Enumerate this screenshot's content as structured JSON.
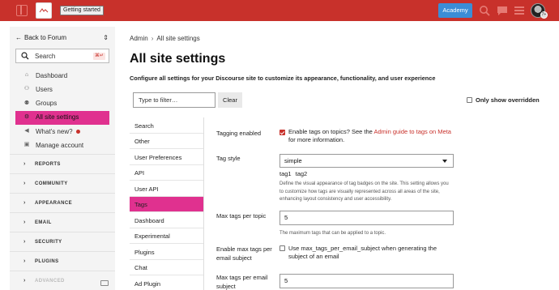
{
  "header": {
    "badge": "Getting started",
    "academy_label": "Academy",
    "icons": [
      "sidebar-toggle-icon",
      "search-icon",
      "chat-icon",
      "hamburger-menu-icon"
    ],
    "avatar_badge": "7+"
  },
  "sidebar": {
    "back_label": "Back to Forum",
    "search": {
      "label": "Search",
      "shortcut": "⌘↵"
    },
    "items": [
      {
        "label": "Dashboard",
        "icon": "home-icon"
      },
      {
        "label": "Users",
        "icon": "users-icon"
      },
      {
        "label": "Groups",
        "icon": "groups-icon"
      },
      {
        "label": "All site settings",
        "icon": "gear-icon",
        "active": true
      },
      {
        "label": "What's new?",
        "icon": "megaphone-icon"
      },
      {
        "label": "Manage account",
        "icon": "account-icon"
      }
    ],
    "sections": [
      "REPORTS",
      "COMMUNITY",
      "APPEARANCE",
      "EMAIL",
      "SECURITY",
      "PLUGINS",
      "ADVANCED"
    ]
  },
  "main": {
    "breadcrumb": {
      "root": "Admin",
      "current": "All site settings"
    },
    "title": "All site settings",
    "description": "Configure all settings for your Discourse site to customize its appearance, functionality, and user experience",
    "filter_placeholder": "Type to filter…",
    "clear_label": "Clear",
    "only_overridden_label": "Only show overridden",
    "categories": [
      "Search",
      "Other",
      "User Preferences",
      "API",
      "User API",
      "Tags",
      "Dashboard",
      "Experimental",
      "Plugins",
      "Chat",
      "Ad Plugin"
    ],
    "active_category": "Tags",
    "settings": {
      "tagging_enabled": {
        "label": "Tagging enabled",
        "text_before": "Enable tags on topics? See the ",
        "link": "Admin guide to tags on Meta",
        "text_after": " for more information."
      },
      "tag_style": {
        "label": "Tag style",
        "value": "simple",
        "preview_tags": [
          "tag1",
          "tag2"
        ],
        "help": "Define the visual appearance of tag badges on the site. This setting allows you to customize how tags are visually represented across all areas of the site, enhancing layout consistency and user accessibility."
      },
      "max_tags_per_topic": {
        "label": "Max tags per topic",
        "value": "5",
        "help": "The maximum tags that can be applied to a topic."
      },
      "enable_max_tags_per_email_subject": {
        "label": "Enable max tags per email subject",
        "text": "Use max_tags_per_email_subject when generating the subject of an email"
      },
      "max_tags_per_email_subject": {
        "label": "Max tags per email subject",
        "value": "5"
      }
    }
  },
  "colors": {
    "brand": "#c8312b",
    "active": "#e0318f",
    "academy": "#3b8dd6"
  }
}
